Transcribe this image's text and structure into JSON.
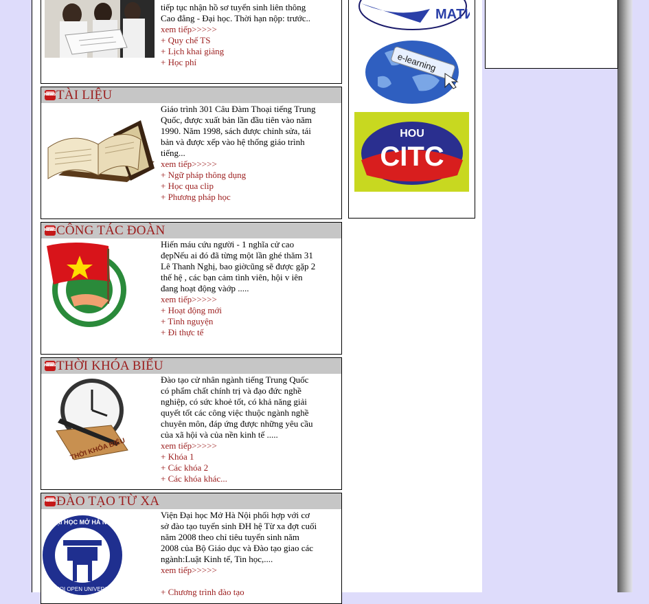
{
  "sections": {
    "tuyensinh": {
      "text": "tiếp tục nhận hồ sơ tuyển sinh liên thông Cao đẳng - Đại học. Thời hạn nộp: trước..",
      "more": "xem tiếp>>>>>",
      "links": [
        "+ Quy chế TS",
        "+ Lịch khai giảng",
        "+ Học phí"
      ]
    },
    "tailieu": {
      "title": "TÀI LIỆU",
      "text": "Giáo trình 301 Câu Đàm Thoại tiếng Trung Quốc, được xuất bản lần đầu tiên vào năm 1990. Năm 1998, sách được chỉnh sửa, tái bản và được xếp vào hệ thống giáo trình tiếng...",
      "more": "xem tiếp>>>>>",
      "links": [
        "+ Ngữ pháp thông dụng",
        "+ Học qua clip",
        "+ Phương pháp học"
      ]
    },
    "congtacdoan": {
      "title": "CÔNG TÁC ĐOÀN",
      "text": "Hiến máu cứu người - 1 nghĩa cử cao đẹpNếu ai đó đã từng một lần ghé thăm 31 Lê Thanh Nghị, bao giờcũng sẽ được gặp 2 thế hệ , các bạn cảm tình viên, hội v iên đang hoạt động vàớp .....",
      "more": "xem tiếp>>>>>",
      "links": [
        "+ Hoạt động mới",
        "+ Tình nguyện",
        "+ Đi thực tế"
      ]
    },
    "thoikhoabieu": {
      "title": "THỜI KHÓA BIỂU",
      "text": "Đào tạo cử nhân ngành tiếng Trung Quốc có phẩm chất chính trị và đạo đức nghề nghiệp, có sức khoẻ tốt, có khả năng giải quyết tốt các công việc thuộc ngành nghề chuyên môn, đáp ứng được những yêu cầu của xã hội và của nền kinh tế .....",
      "more": "xem tiếp>>>>>",
      "links": [
        "+ Khóa 1",
        "+ Các khóa 2",
        "+ Các khóa khác..."
      ],
      "image_label": "THỜI KHÓA BIỂU"
    },
    "daotaotuxa": {
      "title": "ĐÀO TẠO TỪ XA",
      "text": "Viện Đại học Mở Hà Nội phối hợp với cơ sở đào tạo tuyển sinh ĐH hệ Từ xa đợt cuối năm 2008 theo chỉ tiêu tuyển sinh năm 2008 của Bộ Giáo dục và Đào tạo giao các ngành:Luật Kinh tế, Tin học,....",
      "more": "xem tiếp>>>>>",
      "links": [
        "+ Chương trình đào tạo"
      ],
      "image_label_top": "ĐẠI HỌC MỞ HÀ NỘI",
      "image_label_bottom": "HANOI OPEN UNIVERSITY"
    }
  },
  "logos": {
    "mati": "МАТИ",
    "elearning": "e-learning",
    "citc_top": "HOU",
    "citc": "CITC"
  },
  "colors": {
    "page_bg": "#dedcfb",
    "header_bg": "#c6c6c6",
    "accent_red": "#9b1c1c"
  }
}
